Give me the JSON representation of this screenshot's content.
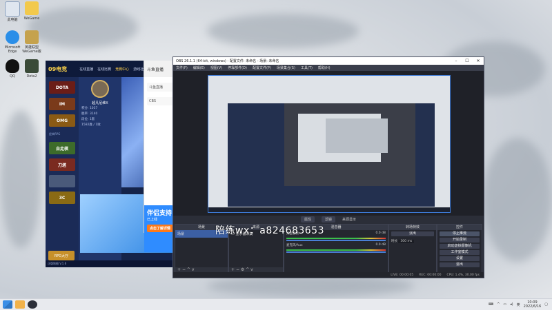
{
  "desktop": {
    "icons": [
      {
        "label": "此电脑",
        "color": "#ffffff"
      },
      {
        "label": "WeGame",
        "color": "#f2c94c"
      },
      {
        "label": "Microsoft Edge",
        "color": "#2a8ee8"
      },
      {
        "label": "英雄联盟WeGame版",
        "color": "#2d3b55"
      },
      {
        "label": "QQ",
        "color": "#ffffff"
      },
      {
        "label": "Dota2",
        "color": "#3a4a38"
      }
    ]
  },
  "game_window": {
    "logo": "09电竞",
    "tabs": [
      "在线直播",
      "在线比赛",
      "竞赛中心",
      "游戏社区"
    ],
    "active_tab_index": 2,
    "side_tiles": [
      "DOTA",
      "IM",
      "OMG",
      "自走棋",
      "刀塔",
      "",
      "3C"
    ],
    "side_category": "经典RPG",
    "rpg_button": "RPG大厅",
    "user_name": "超凡尼维X",
    "user_rows": [
      "积分: 1037",
      "胜率: 3140",
      "段位: 1套",
      "1582胜 / 1败"
    ],
    "status_text": "正版地图 V.1.6"
  },
  "douyu_window": {
    "header": "斗鱼直播",
    "items": [
      "斗鱼直播",
      "CBS"
    ],
    "bottom_title": "伴侣支持",
    "bottom_sub": "已上线",
    "bottom_button": "点击了解详情"
  },
  "obs": {
    "title": "OBS 26.1.1 (64-bit, windows) - 配置文件: 未命名 - 场景: 未命名",
    "menus": [
      "文件(F)",
      "编辑(E)",
      "视图(V)",
      "停靠部件(D)",
      "配置文件(P)",
      "场景集合(S)",
      "工具(T)",
      "帮助(H)"
    ],
    "scene_bar": [
      "属性",
      "滤镜",
      "来源显示"
    ],
    "panels": {
      "scenes": {
        "title": "场景",
        "items": [
          "场景"
        ]
      },
      "sources": {
        "title": "来源",
        "items": [
          "显示器采集"
        ]
      },
      "mixer": {
        "title": "混音器",
        "rows": [
          {
            "name": "桌面音频",
            "value": "0.0 dB"
          },
          {
            "name": "麦克风/Aux",
            "value": "0.0 dB"
          }
        ]
      },
      "transitions": {
        "title": "转场特效",
        "fade": "淡出",
        "duration_label": "时长",
        "duration_value": "300 ms"
      },
      "controls": {
        "title": "控件",
        "buttons": [
          "停止推流",
          "开始录制",
          "启动虚拟摄像机",
          "工作室模式",
          "设置",
          "退出"
        ]
      }
    },
    "status_bar": [
      "LIVE: 00:00:05",
      "REC: 00:00:00",
      "CPU: 1.4%, 30.00 fps"
    ]
  },
  "watermark": "陪练wx：a824683653",
  "taskbar": {
    "icons": [
      "windows-start",
      "jiaoyin",
      "obs"
    ],
    "tray_text": "英",
    "time": "10:09",
    "date": "2022/6/16"
  }
}
